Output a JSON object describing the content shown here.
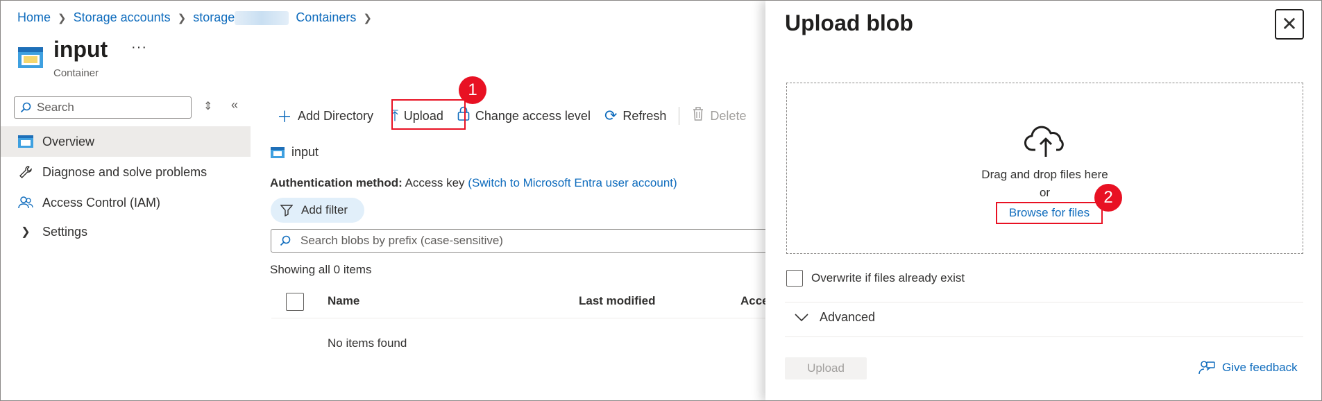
{
  "breadcrumb": {
    "items": [
      "Home",
      "Storage accounts",
      "storage",
      "Containers"
    ]
  },
  "page": {
    "title": "input",
    "more": "···",
    "subtitle": "Container"
  },
  "sidebar": {
    "search_placeholder": "Search",
    "items": [
      {
        "label": "Overview",
        "icon": "container-icon"
      },
      {
        "label": "Diagnose and solve problems",
        "icon": "wrench-icon"
      },
      {
        "label": "Access Control (IAM)",
        "icon": "people-icon"
      },
      {
        "label": "Settings",
        "icon": "chevron-right-icon"
      }
    ]
  },
  "toolbar": {
    "add_directory": "Add Directory",
    "upload": "Upload",
    "change_access": "Change access level",
    "refresh": "Refresh",
    "delete": "Delete"
  },
  "steps": {
    "one": "1",
    "two": "2"
  },
  "content": {
    "path_label": "input",
    "auth_label": "Authentication method:",
    "auth_value": "Access key",
    "auth_link": "(Switch to Microsoft Entra user account)",
    "add_filter": "Add filter",
    "blob_search_placeholder": "Search blobs by prefix (case-sensitive)",
    "showing": "Showing all 0 items",
    "columns": [
      "Name",
      "Last modified",
      "Acce"
    ],
    "empty": "No items found"
  },
  "panel": {
    "title": "Upload blob",
    "drag_text": "Drag and drop files here",
    "or_text": "or",
    "browse": "Browse for files",
    "overwrite": "Overwrite if files already exist",
    "advanced": "Advanced",
    "upload_button": "Upload",
    "feedback": "Give feedback"
  },
  "colors": {
    "accent": "#0f6cbd",
    "highlight": "#e81123",
    "nav_active": "#edebe9"
  }
}
